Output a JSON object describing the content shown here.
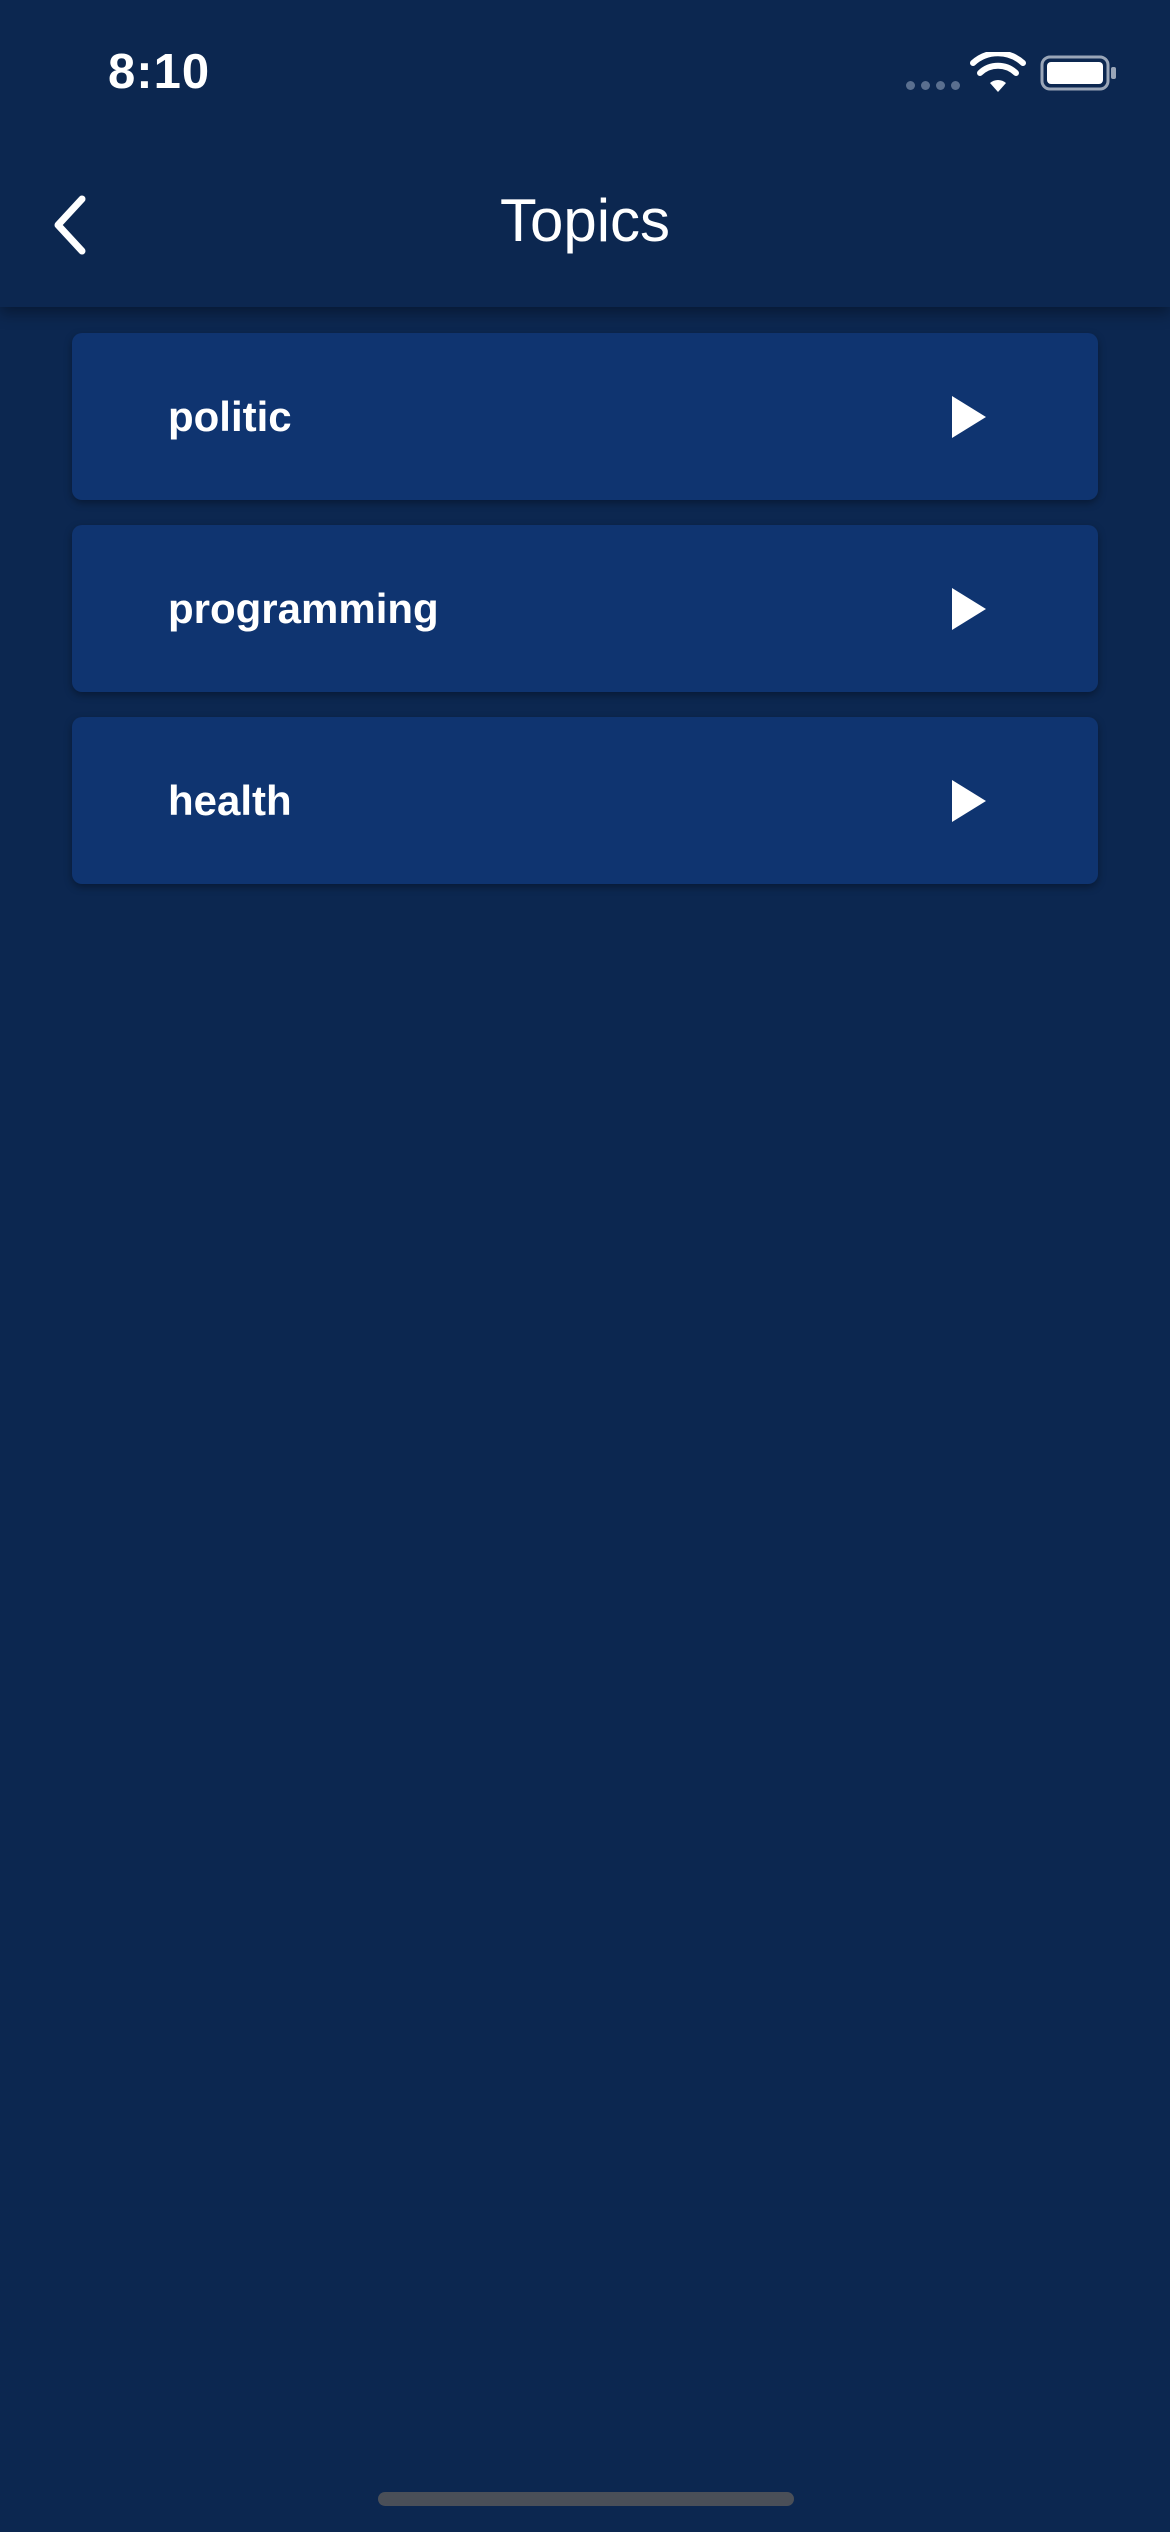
{
  "status_bar": {
    "time": "8:10",
    "icons": [
      "signal-dots-icon",
      "wifi-icon",
      "battery-icon"
    ]
  },
  "header": {
    "title": "Topics",
    "back_icon": "chevron-left-icon"
  },
  "topics": [
    {
      "label": "politic",
      "icon": "play-icon"
    },
    {
      "label": "programming",
      "icon": "play-icon"
    },
    {
      "label": "health",
      "icon": "play-icon"
    }
  ],
  "colors": {
    "background": "#0c2750",
    "card": "#0f3470",
    "text": "#ffffff",
    "home_indicator": "#4a4f58"
  }
}
